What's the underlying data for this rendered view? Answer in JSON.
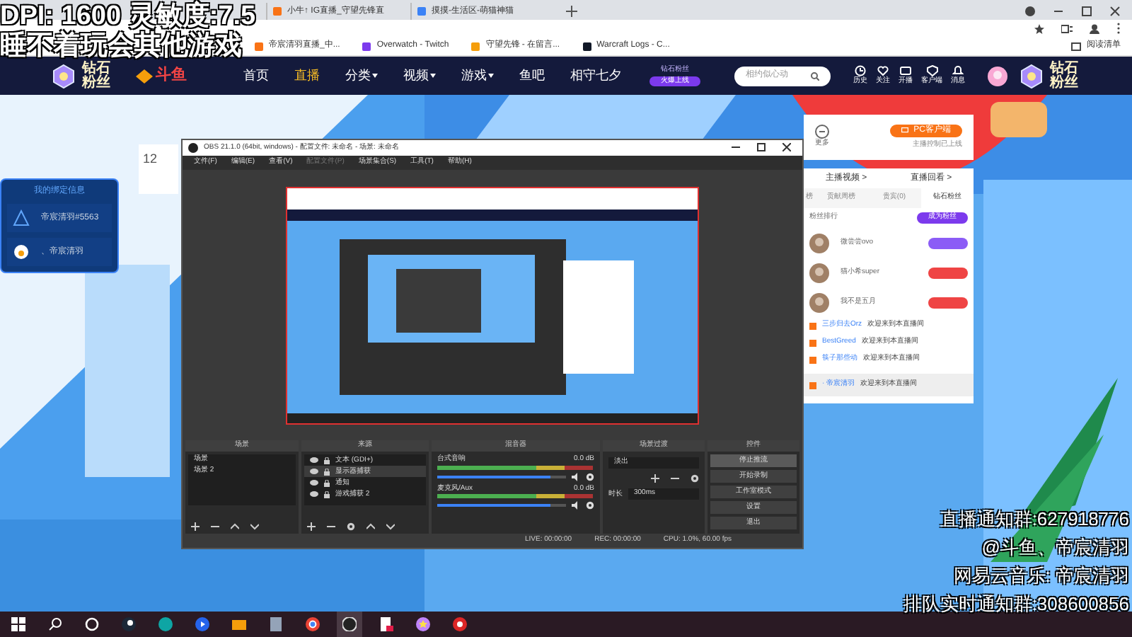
{
  "browser": {
    "tabs": [
      {
        "label": "小牛↑ IG直播_守望先锋直",
        "kind": "douyu"
      },
      {
        "label": "摸摸-生活区-萌猫神猫",
        "kind": "bili"
      }
    ],
    "bookmarks": [
      {
        "label": "帝宸清羽直播_中...",
        "kind": "douyu"
      },
      {
        "label": "Overwatch - Twitch",
        "kind": "twitch"
      },
      {
        "label": "守望先锋 - 在留言...",
        "kind": "ow"
      },
      {
        "label": "Warcraft Logs - C...",
        "kind": "wcl"
      }
    ],
    "reading_list": "阅读清单"
  },
  "site": {
    "logo_left": "钻石粉丝",
    "brand": "斗鱼",
    "nav": [
      {
        "label": "首页",
        "selected": false,
        "dropdown": false
      },
      {
        "label": "直播",
        "selected": true,
        "dropdown": false
      },
      {
        "label": "分类",
        "selected": false,
        "dropdown": true
      },
      {
        "label": "视频",
        "selected": false,
        "dropdown": true
      },
      {
        "label": "游戏",
        "selected": false,
        "dropdown": true
      },
      {
        "label": "鱼吧",
        "selected": false,
        "dropdown": false
      },
      {
        "label": "相守七夕",
        "selected": false,
        "dropdown": false
      }
    ],
    "promo_badge": {
      "title": "钻石粉丝",
      "label": "火爆上线"
    },
    "search": {
      "placeholder": "相约似心动"
    },
    "actions": [
      {
        "label": "历史",
        "kind": "clock"
      },
      {
        "label": "关注",
        "kind": "heart"
      },
      {
        "label": "开播",
        "kind": "video"
      },
      {
        "label": "客户端",
        "kind": "shield"
      },
      {
        "label": "消息",
        "kind": "bell"
      }
    ],
    "logo_right": "钻石粉丝"
  },
  "bind_card": {
    "title": "我的绑定信息",
    "accounts": [
      "帝宸清羽#5563",
      "、帝宸清羽"
    ]
  },
  "card_number": "12",
  "side_panel": {
    "more": "更多",
    "client_button": "PC客户端",
    "client_note": "主播控制已上线",
    "links": [
      "主播视频 >",
      "直播回看 >"
    ],
    "tabs": [
      {
        "label": "榜",
        "selected": false
      },
      {
        "label": "贡献周榜",
        "selected": false
      },
      {
        "label": "贵宾(0)",
        "selected": false
      },
      {
        "label": "钻石粉丝",
        "selected": true
      }
    ],
    "ranking_title": "粉丝排行",
    "join_button": "成为粉丝",
    "fans": [
      {
        "name": "微尝尝ovo",
        "color": "#8b5cf6"
      },
      {
        "name": "猫小希super",
        "color": "#ef4444"
      },
      {
        "name": "我不是五月",
        "color": "#ef4444"
      }
    ],
    "chat": [
      {
        "user": "三步归去Orz",
        "text": "欢迎来到本直播间",
        "highlight": false
      },
      {
        "user": "BestGreed",
        "text": "欢迎来到本直播间",
        "highlight": false
      },
      {
        "user": "筷子那些动",
        "text": "欢迎来到本直播间",
        "highlight": false
      },
      {
        "user": "· 帝宸清羽",
        "text": "欢迎来到本直播间",
        "highlight": true
      }
    ]
  },
  "obs": {
    "title": "OBS 21.1.0 (64bit, windows) - 配置文件: 未命名 - 场景: 未命名",
    "menu": [
      {
        "label": "文件(F)",
        "disabled": false
      },
      {
        "label": "编辑(E)",
        "disabled": false
      },
      {
        "label": "查看(V)",
        "disabled": false
      },
      {
        "label": "配置文件(P)",
        "disabled": true
      },
      {
        "label": "场景集合(S)",
        "disabled": false
      },
      {
        "label": "工具(T)",
        "disabled": false
      },
      {
        "label": "帮助(H)",
        "disabled": false
      }
    ],
    "scenes": {
      "title": "场景",
      "items": [
        {
          "label": "场景",
          "selected": false
        },
        {
          "label": "场景 2",
          "selected": false
        }
      ]
    },
    "sources": {
      "title": "来源",
      "items": [
        {
          "label": "文本 (GDI+)",
          "selected": false
        },
        {
          "label": "显示器捕获",
          "selected": true
        },
        {
          "label": "通知",
          "selected": false
        },
        {
          "label": "游戏捕获 2",
          "selected": false
        }
      ]
    },
    "mixer": {
      "title": "混音器",
      "channels": [
        {
          "name": "台式音响",
          "reading": "0.0 dB",
          "level": 0.88
        },
        {
          "name": "麦克风/Aux",
          "reading": "0.0 dB",
          "level": 0.88
        }
      ]
    },
    "transitions": {
      "title": "场景过渡",
      "value": "淡出",
      "duration_label": "时长",
      "duration": "300ms"
    },
    "controls": {
      "title": "控件",
      "buttons": [
        {
          "label": "停止推流",
          "active": true
        },
        {
          "label": "开始录制",
          "active": false
        },
        {
          "label": "工作室模式",
          "active": false
        },
        {
          "label": "设置",
          "active": false
        },
        {
          "label": "退出",
          "active": false
        }
      ]
    },
    "status": [
      "LIVE: 00:00:00",
      "REC: 00:00:00",
      "CPU: 1.0%, 60.00 fps"
    ]
  },
  "overlay": {
    "top": [
      "DPI: 1600 灵敏度:7.5",
      "睡不着玩会其他游戏"
    ],
    "bottom": [
      "直播通知群:627918776",
      "@斗鱼、帝宸清羽",
      "网易云音乐: 帝宸清羽",
      "排队实时通知群:308600856"
    ]
  },
  "taskbar": {
    "apps": [
      {
        "kind": "start",
        "active": false
      },
      {
        "kind": "search",
        "active": false
      },
      {
        "kind": "ring",
        "active": false
      },
      {
        "kind": "steam",
        "active": false
      },
      {
        "kind": "globe",
        "active": false
      },
      {
        "kind": "play",
        "active": false
      },
      {
        "kind": "folder",
        "active": false
      },
      {
        "kind": "doc",
        "active": false
      },
      {
        "kind": "chrome",
        "active": false
      },
      {
        "kind": "obs",
        "active": true
      },
      {
        "kind": "file",
        "active": false
      },
      {
        "kind": "star",
        "active": false
      },
      {
        "kind": "red",
        "active": false
      }
    ]
  }
}
